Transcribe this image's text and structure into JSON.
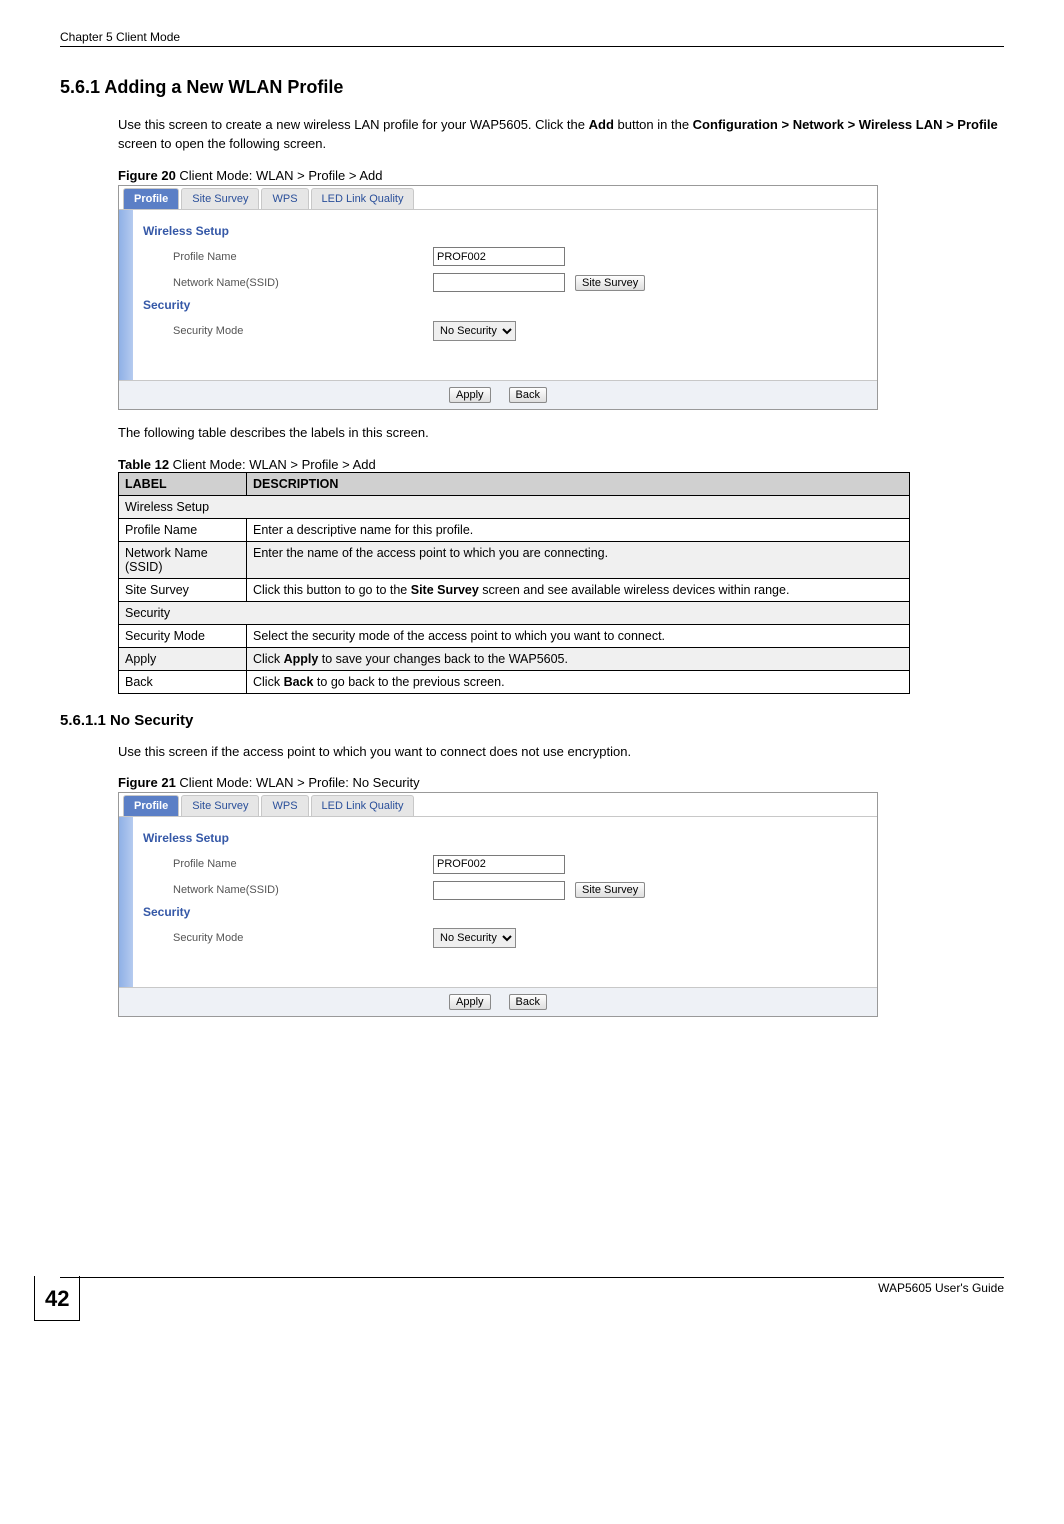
{
  "header": {
    "left": "Chapter 5 Client Mode"
  },
  "section": {
    "num_title": "5.6.1  Adding a New WLAN Profile",
    "intro_a": "Use this screen to create a new wireless LAN profile for your WAP5605. Click the ",
    "intro_add": "Add",
    "intro_b": " button in the ",
    "intro_path": "Configuration > Network > Wireless LAN > Profile",
    "intro_c": " screen to open the following screen."
  },
  "figure20": {
    "bold": "Figure 20",
    "rest": "   Client Mode: WLAN > Profile > Add"
  },
  "ui": {
    "tabs": [
      "Profile",
      "Site Survey",
      "WPS",
      "LED Link Quality"
    ],
    "wireless_setup": "Wireless Setup",
    "profile_name_label": "Profile Name",
    "profile_name_value": "PROF002",
    "network_name_label": "Network Name(SSID)",
    "site_survey_btn": "Site Survey",
    "security": "Security",
    "security_mode_label": "Security Mode",
    "security_mode_value": "No Security",
    "apply_btn": "Apply",
    "back_btn": "Back"
  },
  "table_intro": "The following table describes the labels in this screen.",
  "table12": {
    "bold": "Table 12",
    "rest": "   Client Mode: WLAN > Profile > Add",
    "head_label": "LABEL",
    "head_desc": "DESCRIPTION",
    "rows": [
      {
        "label": "Wireless Setup",
        "desc": "",
        "span": true
      },
      {
        "label": "Profile Name",
        "desc": "Enter a descriptive name for this profile."
      },
      {
        "label": "Network Name (SSID)",
        "desc": "Enter the name of the access point to which you are connecting."
      },
      {
        "label": "Site Survey",
        "desc_pre": "Click this button to go to the ",
        "desc_bold": "Site Survey",
        "desc_post": " screen and see available wireless devices within range."
      },
      {
        "label": "Security",
        "desc": "",
        "span": true
      },
      {
        "label": "Security Mode",
        "desc": "Select the security mode of the access point to which you want to connect."
      },
      {
        "label": "Apply",
        "desc_pre": "Click ",
        "desc_bold": "Apply",
        "desc_post": " to save your changes back to the WAP5605."
      },
      {
        "label": "Back",
        "desc_pre": "Click ",
        "desc_bold": "Back",
        "desc_post": " to go back to the previous screen."
      }
    ]
  },
  "sub": {
    "num_title": "5.6.1.1  No Security",
    "text": "Use this screen if the access point to which you want to connect does not use encryption."
  },
  "figure21": {
    "bold": "Figure 21",
    "rest": "   Client Mode: WLAN > Profile: No Security"
  },
  "footer": {
    "page": "42",
    "guide": "WAP5605 User's Guide"
  }
}
